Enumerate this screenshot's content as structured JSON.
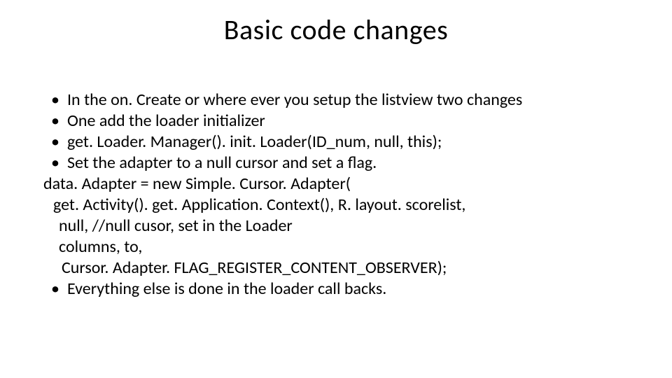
{
  "title": "Basic code changes",
  "bullets_top": [
    "In the on. Create or where ever you setup the listview two changes",
    "One add the loader initializer",
    "get. Loader. Manager(). init. Loader(ID_num, null, this);",
    "Set the adapter to a null cursor and set a flag."
  ],
  "code_lines": [
    {
      "text": "data. Adapter = new Simple. Cursor. Adapter(",
      "indent": 0
    },
    {
      "text": "get. Activity(). get. Application. Context(), R. layout. scorelist,",
      "indent": 1
    },
    {
      "text": "null,   //null cusor, set in the Loader",
      "indent": 2
    },
    {
      "text": "columns, to,",
      "indent": 2
    },
    {
      "text": "Cursor. Adapter. FLAG_REGISTER_CONTENT_OBSERVER);",
      "indent": 3
    }
  ],
  "bullets_bottom": [
    "Everything else is done in the loader call backs."
  ]
}
